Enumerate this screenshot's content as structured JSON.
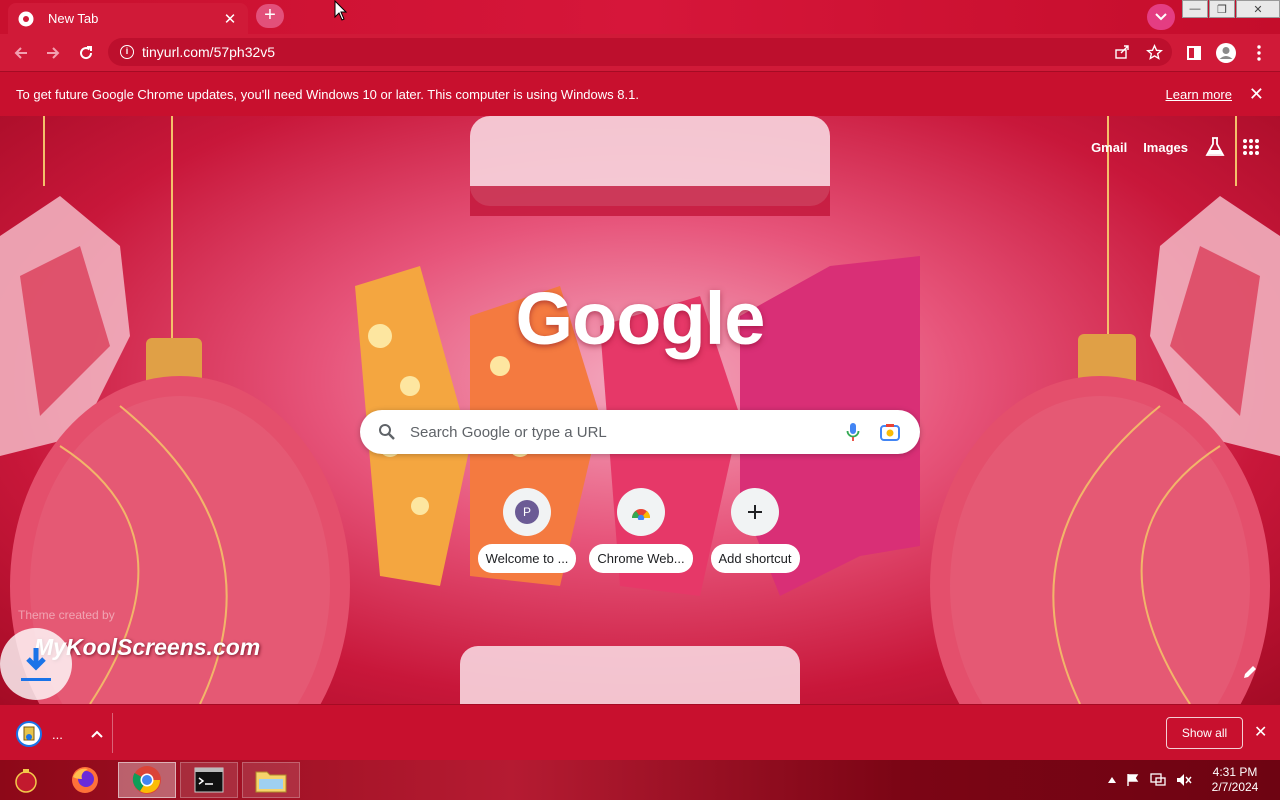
{
  "browser": {
    "tab": {
      "title": "New Tab"
    },
    "address": "tinyurl.com/57ph32v5"
  },
  "infobar": {
    "message": "To get future Google Chrome updates, you'll need Windows 10 or later. This computer is using Windows 8.1.",
    "learn_more": "Learn more"
  },
  "ntp": {
    "top_links": {
      "gmail": "Gmail",
      "images": "Images"
    },
    "logo": "Google",
    "search_placeholder": "Search Google or type a URL",
    "shortcuts": [
      {
        "label": "Welcome to ...",
        "avatar_letter": "P"
      },
      {
        "label": "Chrome Web..."
      },
      {
        "label": "Add shortcut"
      }
    ],
    "theme_credit": "Theme created by",
    "theme_brand": "MyKoolScreens.com"
  },
  "downloads": {
    "item_label": "...",
    "show_all": "Show all"
  },
  "taskbar": {
    "clock_time": "4:31 PM",
    "clock_date": "2/7/2024"
  },
  "colors": {
    "theme_red": "#c8102e",
    "accent_pink": "#e43d82"
  }
}
